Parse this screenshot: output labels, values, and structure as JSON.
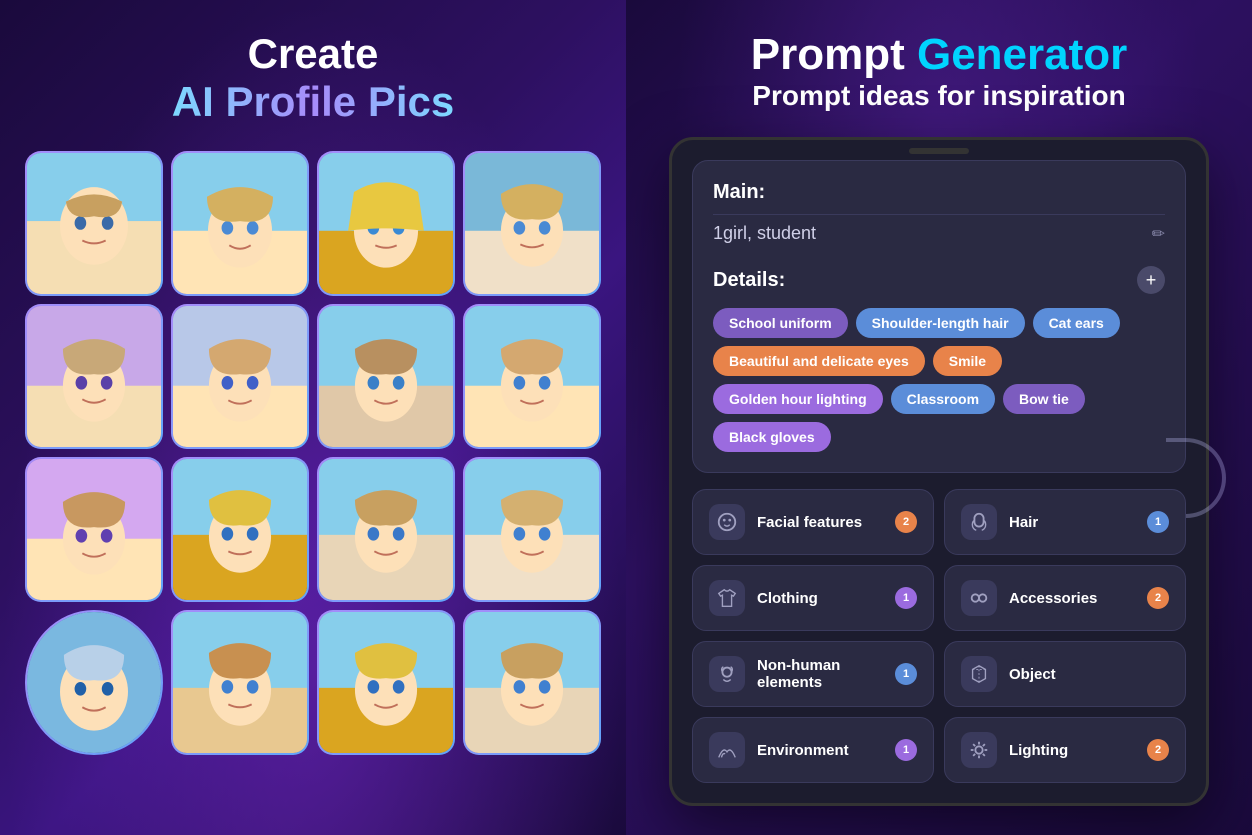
{
  "left": {
    "title_create": "Create",
    "title_sub": "AI Profile Pics",
    "images": [
      {
        "id": 1,
        "class": "girl-1"
      },
      {
        "id": 2,
        "class": "girl-2"
      },
      {
        "id": 3,
        "class": "girl-3"
      },
      {
        "id": 4,
        "class": "girl-4"
      },
      {
        "id": 5,
        "class": "girl-5"
      },
      {
        "id": 6,
        "class": "girl-6"
      },
      {
        "id": 7,
        "class": "girl-7"
      },
      {
        "id": 8,
        "class": "girl-8"
      },
      {
        "id": 9,
        "class": "girl-9"
      },
      {
        "id": 10,
        "class": "girl-10"
      },
      {
        "id": 11,
        "class": "girl-11"
      },
      {
        "id": 12,
        "class": "girl-12"
      },
      {
        "id": 13,
        "class": "girl-13",
        "shape": "circle"
      },
      {
        "id": 14,
        "class": "girl-14"
      },
      {
        "id": 15,
        "class": "girl-15"
      },
      {
        "id": 16,
        "class": "girl-16"
      }
    ]
  },
  "right": {
    "title_prompt": "Prompt",
    "title_generator": "Generator",
    "title_sub": "Prompt ideas for inspiration",
    "main_label": "Main:",
    "main_value": "1girl, student",
    "edit_icon": "✏",
    "details_label": "Details:",
    "plus_icon": "+",
    "tags": [
      {
        "label": "School uniform",
        "color": "tag-purple"
      },
      {
        "label": "Shoulder-length hair",
        "color": "tag-blue"
      },
      {
        "label": "Cat ears",
        "color": "tag-blue"
      },
      {
        "label": "Beautiful and delicate eyes",
        "color": "tag-orange"
      },
      {
        "label": "Smile",
        "color": "tag-orange"
      },
      {
        "label": "Golden hour lighting",
        "color": "tag-light-purple"
      },
      {
        "label": "Classroom",
        "color": "tag-blue"
      },
      {
        "label": "Bow tie",
        "color": "tag-purple"
      },
      {
        "label": "Black gloves",
        "color": "tag-light-purple"
      }
    ],
    "categories": [
      {
        "icon": "😊",
        "label": "Facial\nfeatures",
        "badge": "2",
        "badge_color": "badge-orange"
      },
      {
        "icon": "👤",
        "label": "Hair",
        "badge": "1",
        "badge_color": "badge-blue"
      },
      {
        "icon": "👕",
        "label": "Clothing",
        "badge": "1",
        "badge_color": "badge-purple"
      },
      {
        "icon": "🎭",
        "label": "Accessories",
        "badge": "2",
        "badge_color": "badge-orange"
      },
      {
        "icon": "🐾",
        "label": "Non-human\nelements",
        "badge": "1",
        "badge_color": "badge-blue"
      },
      {
        "icon": "📦",
        "label": "Object",
        "badge": "",
        "badge_color": ""
      },
      {
        "icon": "🌿",
        "label": "Environment",
        "badge": "1",
        "badge_color": "badge-purple"
      },
      {
        "icon": "☀",
        "label": "Lighting",
        "badge": "2",
        "badge_color": "badge-orange"
      }
    ]
  }
}
